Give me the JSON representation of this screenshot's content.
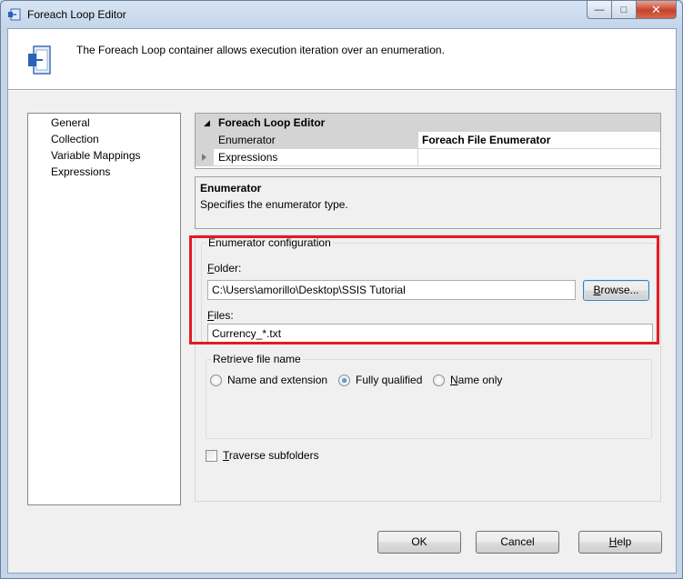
{
  "window": {
    "title": "Foreach Loop Editor",
    "controls": {
      "minimize": "—",
      "maximize": "□",
      "close": "✕"
    }
  },
  "header": {
    "description": "The Foreach Loop container allows execution iteration over an enumeration.",
    "icon": "foreach-loop-icon"
  },
  "nav": {
    "items": [
      "General",
      "Collection",
      "Variable Mappings",
      "Expressions"
    ],
    "selected": "Collection"
  },
  "property_grid": {
    "category": "Foreach Loop Editor",
    "rows": [
      {
        "name": "Enumerator",
        "value": "Foreach File Enumerator"
      },
      {
        "name": "Expressions",
        "value": ""
      }
    ]
  },
  "description_box": {
    "title": "Enumerator",
    "text": "Specifies the enumerator type."
  },
  "config": {
    "group_title": "Enumerator configuration",
    "folder_label_u": "F",
    "folder_label_rest": "older:",
    "folder_value": "C:\\Users\\amorillo\\Desktop\\SSIS Tutorial",
    "browse_u": "B",
    "browse_rest": "rowse...",
    "files_label_u": "F",
    "files_label_rest": "iles:",
    "files_value": "Currency_*.txt",
    "retrieve_title": "Retrieve file name",
    "radio_options": [
      "Name and extension",
      "Fully qualified",
      "Name only"
    ],
    "radio_selected": "Fully qualified",
    "name_only_u": "N",
    "name_only_rest": "ame only",
    "traverse_u": "T",
    "traverse_rest": "raverse subfolders",
    "traverse_checked": false
  },
  "footer": {
    "ok": "OK",
    "cancel": "Cancel",
    "help_u": "H",
    "help_rest": "elp"
  },
  "colors": {
    "highlight": "#e31b23",
    "radio_selected": "#0f5a99"
  }
}
